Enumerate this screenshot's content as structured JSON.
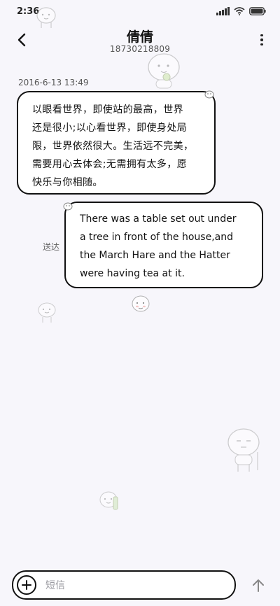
{
  "status_bar": {
    "time": "2:36"
  },
  "header": {
    "contact_name": "倩倩",
    "contact_number": "18730218809"
  },
  "conversation": {
    "timestamp": "2016-6-13 13:49",
    "incoming": {
      "lines": [
        "以眼看世界，即使站的最高，世界",
        "还是很小;以心看世界，即使身处局",
        "限，世界依然很大。生活远不完美，",
        "需要用心去体会;无需拥有太多，愿",
        "快乐与你相随。"
      ]
    },
    "outgoing": {
      "lines": [
        "There was a table set out under",
        "a tree in front of the house,and",
        "the March Hare and the Hatter",
        "were having tea at it."
      ],
      "status": "送达"
    }
  },
  "composer": {
    "placeholder": "短信"
  },
  "icons": {
    "back": "back-arrow-icon",
    "more": "more-vertical-icon",
    "add": "add-circle-icon",
    "send": "send-arrow-up-icon"
  }
}
